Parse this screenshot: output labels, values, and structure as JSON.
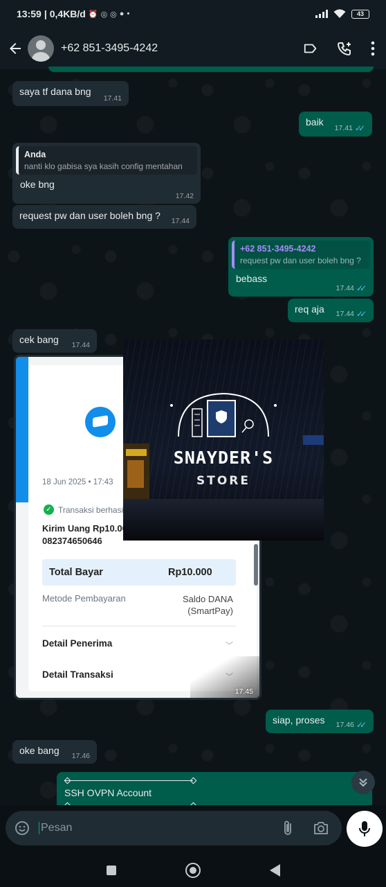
{
  "status_bar": {
    "time": "13:59",
    "speed": "0,4KB/d",
    "battery": "43",
    "icons": [
      "alarm-icon",
      "whatsapp-icon",
      "whatsapp-icon",
      "chat-icon"
    ]
  },
  "header": {
    "contact_name": "+62 851-3495-4242",
    "icons": [
      "back-arrow-icon",
      "label-icon",
      "add-call-icon",
      "more-vert-icon"
    ]
  },
  "messages": [
    {
      "id": "m1",
      "direction": "in",
      "text": "saya tf dana bng",
      "time": "17.41"
    },
    {
      "id": "m2",
      "direction": "out",
      "text": "baik",
      "time": "17.41",
      "read": true
    },
    {
      "id": "m3",
      "direction": "in",
      "quote_author": "Anda",
      "quote_text": "nanti klo gabisa sya kasih config mentahan",
      "text": "oke bng",
      "time": "17.42"
    },
    {
      "id": "m4",
      "direction": "in",
      "text": "request pw dan user boleh bng ?",
      "time": "17.44"
    },
    {
      "id": "m5",
      "direction": "out",
      "quote_author": "+62 851-3495-4242",
      "quote_text": "request pw dan user boleh bng ?",
      "text": "bebass",
      "time": "17.44",
      "read": true
    },
    {
      "id": "m6",
      "direction": "out",
      "text": "req aja",
      "time": "17.44",
      "read": true
    },
    {
      "id": "m7",
      "direction": "in",
      "text": "cek bang",
      "time": "17.44"
    },
    {
      "id": "m8",
      "direction": "in",
      "type": "image",
      "time": "17.45"
    },
    {
      "id": "m9",
      "direction": "out",
      "text": "siap, proses",
      "time": "17.46",
      "read": true
    },
    {
      "id": "m10",
      "direction": "in",
      "text": "oke bang",
      "time": "17.46"
    },
    {
      "id": "m11",
      "direction": "out",
      "text": "SSH OVPN Account"
    }
  ],
  "receipt": {
    "date": "18 Jun 2025 • 17:43",
    "status": "Transaksi berhasil",
    "send": "Kirim Uang Rp10.00",
    "phone": "082374650646",
    "total_label": "Total Bayar",
    "total_value": "Rp10.000",
    "method_label": "Metode Pembayaran",
    "method_value": "Saldo DANA (SmartPay)",
    "detail_receiver": "Detail Penerima",
    "detail_transaction": "Detail Transaksi"
  },
  "watermark": {
    "title": "SNAYDER'S",
    "subtitle": "STORE"
  },
  "input": {
    "placeholder": "Pesan"
  },
  "colors": {
    "incoming": "#202c33",
    "outgoing": "#005c4b",
    "read_tick": "#53bdeb",
    "accent": "#00a884"
  }
}
